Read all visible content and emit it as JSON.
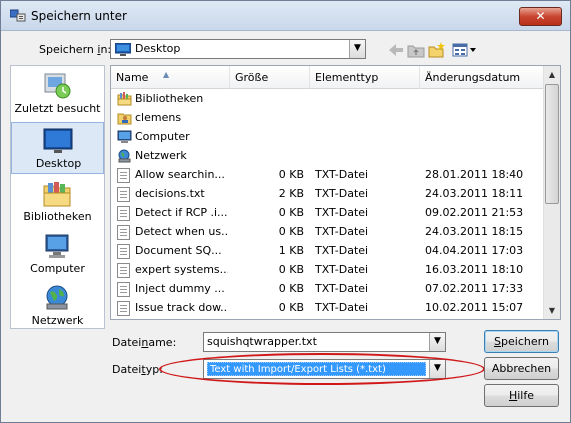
{
  "window": {
    "title": "Speichern unter",
    "close_label": "✕"
  },
  "toolbar": {
    "savein_label_prefix": "Speichern ",
    "savein_label_underlined": "i",
    "savein_label_suffix": "n:",
    "location_value": "Desktop",
    "icons": [
      "back-icon",
      "up-folder-icon",
      "new-folder-icon",
      "view-menu-icon"
    ]
  },
  "places": [
    {
      "label": "Zuletzt besucht",
      "icon": "recent-places-icon"
    },
    {
      "label": "Desktop",
      "icon": "desktop-icon"
    },
    {
      "label": "Bibliotheken",
      "icon": "libraries-icon"
    },
    {
      "label": "Computer",
      "icon": "computer-icon"
    },
    {
      "label": "Netzwerk",
      "icon": "network-icon"
    }
  ],
  "columns": [
    "Name",
    "Größe",
    "Elementtyp",
    "Änderungsdatum"
  ],
  "files": [
    {
      "name": "Bibliotheken",
      "size": "",
      "type": "",
      "date": "",
      "icon": "library-folder-icon"
    },
    {
      "name": "clemens",
      "size": "",
      "type": "",
      "date": "",
      "icon": "user-folder-icon"
    },
    {
      "name": "Computer",
      "size": "",
      "type": "",
      "date": "",
      "icon": "computer-icon"
    },
    {
      "name": "Netzwerk",
      "size": "",
      "type": "",
      "date": "",
      "icon": "network-icon"
    },
    {
      "name": "Allow searchin...",
      "size": "0 KB",
      "type": "TXT-Datei",
      "date": "28.01.2011 18:40",
      "icon": "text-file-icon"
    },
    {
      "name": "decisions.txt",
      "size": "2 KB",
      "type": "TXT-Datei",
      "date": "24.03.2011 18:11",
      "icon": "text-file-icon"
    },
    {
      "name": "Detect if RCP .i...",
      "size": "0 KB",
      "type": "TXT-Datei",
      "date": "09.02.2011 21:53",
      "icon": "text-file-icon"
    },
    {
      "name": "Detect when us...",
      "size": "0 KB",
      "type": "TXT-Datei",
      "date": "24.03.2011 18:15",
      "icon": "text-file-icon"
    },
    {
      "name": "Document SQ...",
      "size": "1 KB",
      "type": "TXT-Datei",
      "date": "04.04.2011 17:03",
      "icon": "text-file-icon"
    },
    {
      "name": "expert systems...",
      "size": "0 KB",
      "type": "TXT-Datei",
      "date": "16.03.2011 18:10",
      "icon": "text-file-icon"
    },
    {
      "name": "Inject dummy ...",
      "size": "0 KB",
      "type": "TXT-Datei",
      "date": "07.02.2011 17:33",
      "icon": "text-file-icon"
    },
    {
      "name": "Issue track dow...",
      "size": "0 KB",
      "type": "TXT-Datei",
      "date": "10.02.2011 15:07",
      "icon": "text-file-icon"
    }
  ],
  "filename": {
    "label_prefix": "Datei",
    "label_underlined": "n",
    "label_suffix": "ame:",
    "value": "squishqtwrapper.txt"
  },
  "filetype": {
    "label_prefix": "Datei",
    "label_underlined": "t",
    "label_suffix": "yp:",
    "value": "Text with Import/Export Lists (*.txt)"
  },
  "buttons": {
    "save_prefix": "",
    "save_underlined": "S",
    "save_suffix": "peichern",
    "cancel": "Abbrechen",
    "help_prefix": "",
    "help_underlined": "H",
    "help_suffix": "ilfe"
  },
  "colors": {
    "selection_blue": "#3399ff",
    "annotation_red": "#d01818",
    "close_red": "#c9452f"
  }
}
